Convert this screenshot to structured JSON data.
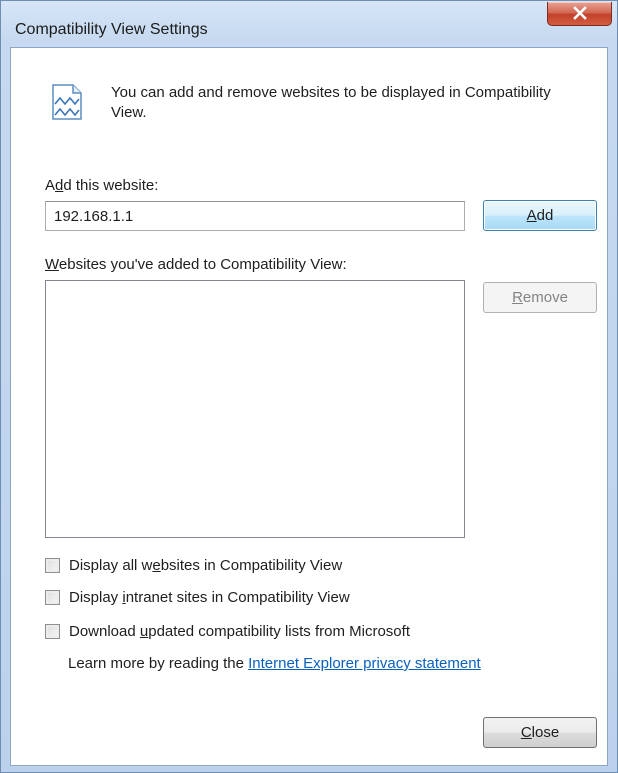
{
  "window": {
    "title": "Compatibility View Settings"
  },
  "info": {
    "text": "You can add and remove websites to be displayed in Compatibility View."
  },
  "add_website": {
    "label_pre": "A",
    "label_accel": "d",
    "label_post": "d this website:",
    "input_value": "192.168.1.1",
    "add_button": "Add"
  },
  "sites_list": {
    "label_accel": "W",
    "label_post": "ebsites you've added to Compatibility View:",
    "items": [],
    "remove_button": "Remove"
  },
  "options": {
    "opt1": {
      "pre": "Display all w",
      "accel": "e",
      "post": "bsites in Compatibility View",
      "checked": false
    },
    "opt2": {
      "pre": "Display ",
      "accel": "i",
      "post": "ntranet sites in Compatibility View",
      "checked": false
    },
    "opt3": {
      "pre": "Download ",
      "accel": "u",
      "post": "pdated compatibility lists from Microsoft",
      "checked": false
    }
  },
  "learn_more": {
    "text": "Learn more by reading the ",
    "link": "Internet Explorer privacy statement"
  },
  "footer": {
    "close_button": "Close"
  },
  "colors": {
    "link": "#0a60bf",
    "close_x": "#c2412a",
    "frame": "#c6d9f0"
  },
  "icons": {
    "close": "close-icon",
    "info": "compatibility-view-icon"
  }
}
